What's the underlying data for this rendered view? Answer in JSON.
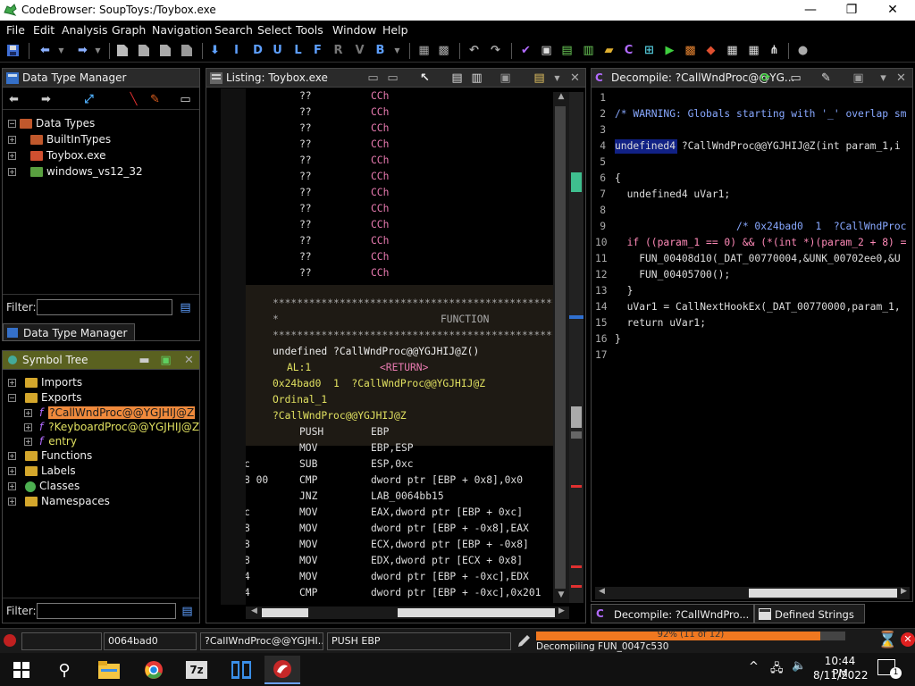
{
  "window": {
    "title": "CodeBrowser: SoupToys:/Toybox.exe",
    "minimize": "—",
    "maximize": "❐",
    "close": "✕"
  },
  "menu": [
    "File",
    "Edit",
    "Analysis",
    "Graph",
    "Navigation",
    "Search",
    "Select",
    "Tools",
    "Window",
    "Help"
  ],
  "toolbar_letters": [
    "I",
    "D",
    "U",
    "L",
    "F",
    "R",
    "V",
    "B"
  ],
  "data_type_manager": {
    "title": "Data Type Manager",
    "root": "Data Types",
    "items": [
      "BuiltInTypes",
      "Toybox.exe",
      "windows_vs12_32"
    ],
    "filter_label": "Filter:",
    "tab_label": "Data Type Manager"
  },
  "symbol_tree": {
    "title": "Symbol Tree",
    "imports": "Imports",
    "exports": "Exports",
    "exports_items": [
      "?CallWndProc@@YGJHIJ@Z",
      "?KeyboardProc@@YGJHIJ@Z",
      "entry"
    ],
    "others": [
      "Functions",
      "Labels",
      "Classes",
      "Namespaces"
    ],
    "filter_label": "Filter:"
  },
  "listing": {
    "title": "Listing:  Toybox.exe",
    "data_rows": [
      {
        "a": "??",
        "b": "CCh"
      },
      {
        "a": "??",
        "b": "CCh"
      },
      {
        "a": "??",
        "b": "CCh"
      },
      {
        "a": "??",
        "b": "CCh"
      },
      {
        "a": "??",
        "b": "CCh"
      },
      {
        "a": "??",
        "b": "CCh"
      },
      {
        "a": "??",
        "b": "CCh"
      },
      {
        "a": "??",
        "b": "CCh"
      },
      {
        "a": "??",
        "b": "CCh"
      },
      {
        "a": "??",
        "b": "CCh"
      },
      {
        "a": "??",
        "b": "CCh"
      },
      {
        "a": "??",
        "b": "CCh"
      }
    ],
    "stars": "****************************************************",
    "star_mid": "*",
    "function_label": "FUNCTION",
    "signature": "undefined ?CallWndProc@@YGJHIJ@Z()",
    "ret_reg": "AL:1",
    "ret_label": "<RETURN>",
    "xref": "0x24bad0  1  ?CallWndProc@@YGJHIJ@Z",
    "ordinal": "Ordinal_1",
    "label": "?CallWndProc@@YGJHIJ@Z",
    "instructions": [
      {
        "b": "",
        "m": "PUSH",
        "o": "EBP"
      },
      {
        "b": "",
        "m": "MOV",
        "o": "EBP,ESP"
      },
      {
        "b": "c",
        "m": "SUB",
        "o": "ESP,0xc"
      },
      {
        "b": "8 00",
        "m": "CMP",
        "o": "dword ptr [EBP + 0x8],0x0"
      },
      {
        "b": "",
        "m": "JNZ",
        "o": "LAB_0064bb15"
      },
      {
        "b": "c",
        "m": "MOV",
        "o": "EAX,dword ptr [EBP + 0xc]"
      },
      {
        "b": "8",
        "m": "MOV",
        "o": "dword ptr [EBP + -0x8],EAX"
      },
      {
        "b": "8",
        "m": "MOV",
        "o": "ECX,dword ptr [EBP + -0x8]"
      },
      {
        "b": "8",
        "m": "MOV",
        "o": "EDX,dword ptr [ECX + 0x8]"
      },
      {
        "b": "4",
        "m": "MOV",
        "o": "dword ptr [EBP + -0xc],EDX"
      },
      {
        "b": "4",
        "m": "CMP",
        "o": "dword ptr [EBP + -0xc],0x201"
      }
    ]
  },
  "decompile": {
    "title": "Decompile: ?CallWndProc@@YG...",
    "line_numbers": [
      "1",
      "2",
      "3",
      "4",
      "5",
      "6",
      "7",
      "8",
      "9",
      "10",
      "11",
      "12",
      "13",
      "14",
      "15",
      "16",
      "17"
    ],
    "lines": [
      "",
      "/* WARNING: Globals starting with '_' overlap sm",
      "",
      "undefined4 ?CallWndProc@@YGJHIJ@Z(int param_1,i",
      "",
      "{",
      "  undefined4 uVar1;",
      "",
      "                    /* 0x24bad0  1  ?CallWndProc",
      "  if ((param_1 == 0) && (*(int *)(param_2 + 8) =",
      "    FUN_00408d10(_DAT_00770004,&UNK_00702ee0,&U",
      "    FUN_00405700();",
      "  }",
      "  uVar1 = CallNextHookEx(_DAT_00770000,param_1,",
      "  return uVar1;",
      "}",
      ""
    ],
    "tabs": [
      "Decompile: ?CallWndPro...",
      "Defined Strings"
    ]
  },
  "status": {
    "address": "0064bad0",
    "function": "?CallWndProc@@YGJHI...",
    "instruction": "PUSH EBP",
    "progress_text": "92% (11 of 12)",
    "progress": 0.92,
    "task": "Decompiling FUN_0047c530"
  },
  "taskbar": {
    "time": "10:44 PM",
    "date": "8/11/2022",
    "notifications": "1",
    "sevenzip": "7z"
  },
  "colors": {
    "pink": "#e87ab0",
    "mnemonic": "#e0e0e0",
    "operand_reg": "#ff7fa0",
    "keyword": "#88a8ff",
    "function_bg": "#1e1a14",
    "highlight": "#f08a3c",
    "progress": "#f07820"
  }
}
